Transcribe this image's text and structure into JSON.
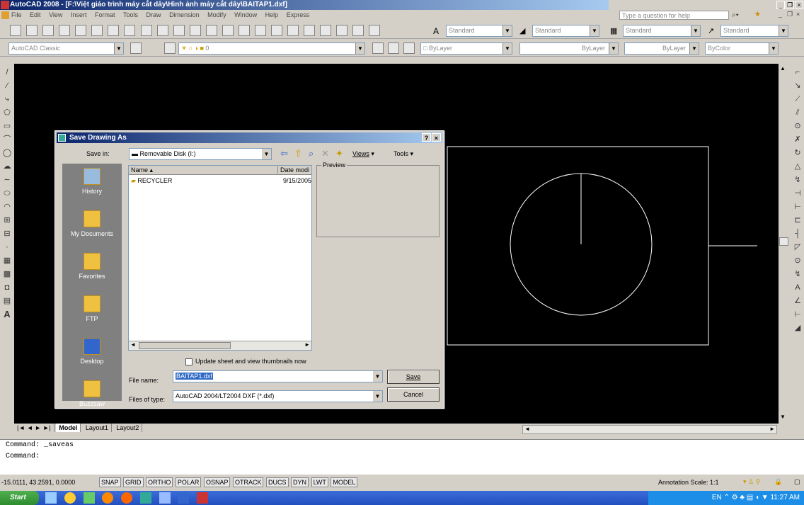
{
  "app": {
    "title": "AutoCAD 2008 - [F:\\Việt giáo trình máy cắt dây\\Hình ảnh máy cắt dây\\BAITAP1.dxf]"
  },
  "menu": [
    "File",
    "Edit",
    "View",
    "Insert",
    "Format",
    "Tools",
    "Draw",
    "Dimension",
    "Modify",
    "Window",
    "Help",
    "Express"
  ],
  "help_placeholder": "Type a question for help",
  "toolbar1": {
    "style1": "Standard",
    "style2": "Standard",
    "style3": "Standard",
    "style4": "Standard"
  },
  "toolbar2": {
    "workspace": "AutoCAD Classic",
    "layer": "0",
    "color": "ByLayer",
    "linetype": "ByLayer",
    "lineweight": "ByLayer",
    "plotstyle": "ByColor"
  },
  "dialog": {
    "title": "Save Drawing As",
    "save_in_label": "Save in:",
    "save_in_value": "Removable Disk (I:)",
    "views_label": "Views",
    "tools_label": "Tools",
    "places": [
      "History",
      "My Documents",
      "Favorites",
      "FTP",
      "Desktop",
      "Buzzsaw"
    ],
    "col_name": "Name",
    "col_date": "Date modi",
    "files": [
      {
        "name": "RECYCLER",
        "date": "9/15/2005"
      }
    ],
    "preview_label": "Preview",
    "thumb_label": "Update sheet and view thumbnails now",
    "file_name_label": "File name:",
    "file_name_value": "BAITAP1.dxf",
    "files_type_label": "Files of type:",
    "files_type_value": "AutoCAD 2004/LT2004 DXF (*.dxf)",
    "save_button": "Save",
    "cancel_button": "Cancel"
  },
  "tabs": [
    "Model",
    "Layout1",
    "Layout2"
  ],
  "command": {
    "line1": "Command:  _saveas",
    "line2": "Command:"
  },
  "status": {
    "coords": "-15.0111, 43.2591, 0.0000",
    "buttons": [
      "SNAP",
      "GRID",
      "ORTHO",
      "POLAR",
      "OSNAP",
      "OTRACK",
      "DUCS",
      "DYN",
      "LWT",
      "MODEL"
    ],
    "annotation_scale": "Annotation Scale: 1:1"
  },
  "taskbar": {
    "start": "Start",
    "lang": "EN",
    "time": "11:27 AM"
  }
}
